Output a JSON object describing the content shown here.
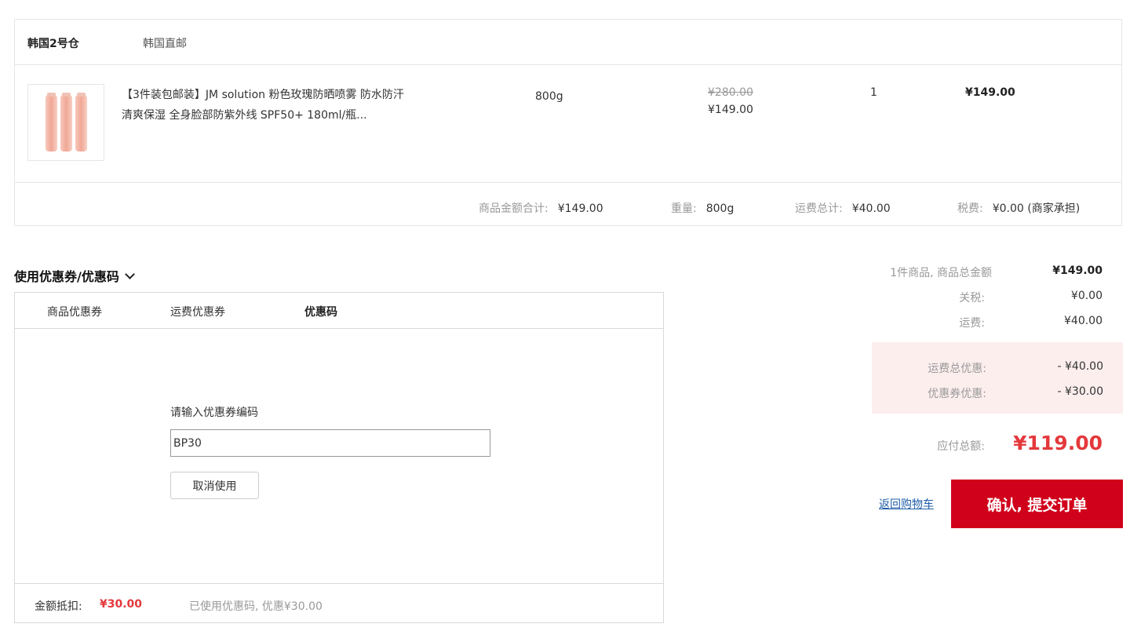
{
  "warehouse": {
    "name": "韩国2号仓",
    "type": "韩国直邮"
  },
  "product": {
    "image_icon": "product-image",
    "title": "【3件装包邮装】JM solution 粉色玫瑰防晒喷雾 防水防汗 清爽保湿 全身脸部防紫外线 SPF50+ 180ml/瓶...",
    "spec": "800g",
    "original_price": "¥280.00",
    "price": "¥149.00",
    "quantity": "1",
    "subtotal": "¥149.00"
  },
  "warehouse_footer": {
    "goods_total_label": "商品金额合计:",
    "goods_total_value": "¥149.00",
    "weight_label": "重量:",
    "weight_value": "800g",
    "shipping_label": "运费总计:",
    "shipping_value": "¥40.00",
    "tax_label": "税费:",
    "tax_value": "¥0.00 (商家承担)"
  },
  "coupon": {
    "title": "使用优惠券/优惠码",
    "tabs": [
      "商品优惠券",
      "运费优惠券",
      "优惠码"
    ],
    "active_tab": "优惠码",
    "input_label": "请输入优惠券编码",
    "input_value": "BP30",
    "cancel_label": "取消使用",
    "deduct_label": "金额抵扣:",
    "deduct_value": "¥30.00",
    "used_text": "已使用优惠码, 优惠¥30.00"
  },
  "summary": {
    "goods_label": "1件商品, 商品总金额",
    "goods_value": "¥149.00",
    "duty_label": "关税:",
    "duty_value": "¥0.00",
    "shipping_label": "运费:",
    "shipping_value": "¥40.00",
    "shipping_discount_label": "运费总优惠:",
    "shipping_discount_value": "- ¥40.00",
    "coupon_discount_label": "优惠券优惠:",
    "coupon_discount_value": "- ¥30.00",
    "payable_label": "应付总额:",
    "payable_value": "¥119.00"
  },
  "actions": {
    "back_label": "返回购物车",
    "submit_label": "确认, 提交订单"
  },
  "colors": {
    "accent_red": "#e4393c",
    "submit_red": "#d0021b",
    "discount_bg": "#fdeeee",
    "link_blue": "#1f5da8"
  }
}
